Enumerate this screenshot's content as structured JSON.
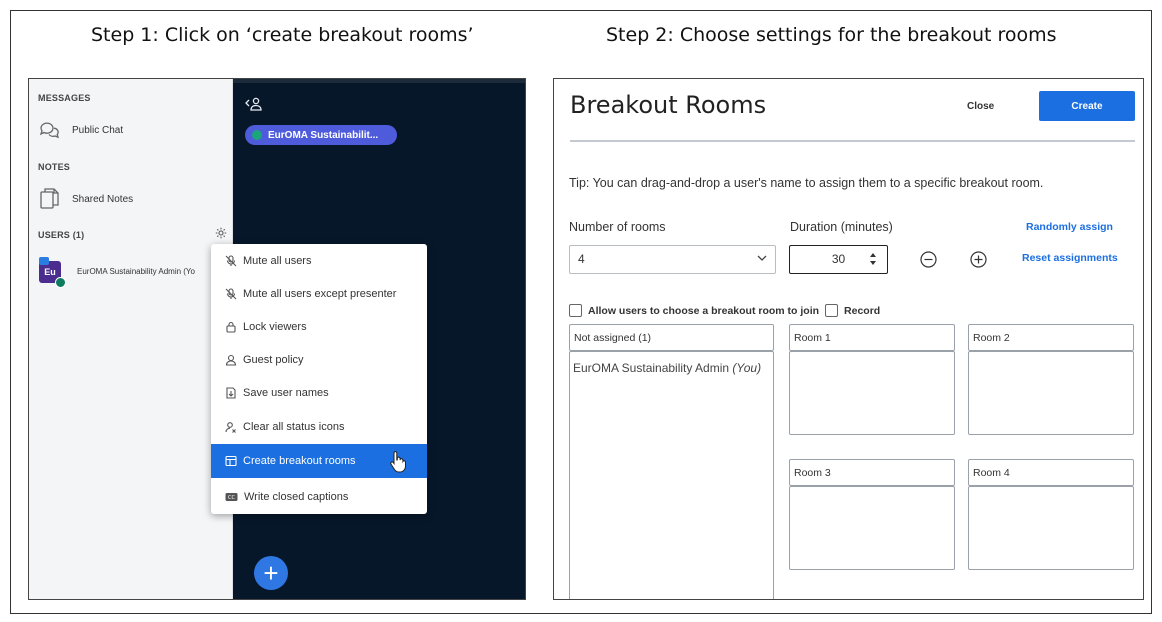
{
  "captions": {
    "step1": "Step 1: Click on ‘create breakout rooms’",
    "step2": "Step 2: Choose settings for the breakout rooms"
  },
  "left_panel": {
    "messages_header": "MESSAGES",
    "public_chat": "Public Chat",
    "notes_header": "NOTES",
    "shared_notes": "Shared Notes",
    "users_header": "USERS (1)",
    "user_avatar": "Eu",
    "user_name": "EurOMA Sustainability Admin (Yo",
    "chat_pill": "EurOMA Sustainabilit..."
  },
  "user_menu": {
    "items": [
      {
        "label": "Mute all users",
        "icon": "mute-icon"
      },
      {
        "label": "Mute all users except presenter",
        "icon": "mute-icon"
      },
      {
        "label": "Lock viewers",
        "icon": "lock-icon"
      },
      {
        "label": "Guest policy",
        "icon": "user-icon"
      },
      {
        "label": "Save user names",
        "icon": "download-icon"
      },
      {
        "label": "Clear all status icons",
        "icon": "clear-status-icon"
      },
      {
        "label": "Create breakout rooms",
        "icon": "rooms-icon",
        "active": true
      },
      {
        "label": "Write closed captions",
        "icon": "cc-icon"
      }
    ]
  },
  "breakout": {
    "title": "Breakout Rooms",
    "close": "Close",
    "create": "Create",
    "tip": "Tip: You can drag-and-drop a user's name to assign them to a specific breakout room.",
    "rooms_label": "Number of rooms",
    "rooms_value": "4",
    "duration_label": "Duration (minutes)",
    "duration_value": "30",
    "randomly_assign": "Randomly assign",
    "reset_assignments": "Reset assignments",
    "allow_choose": "Allow users to choose a breakout room to join",
    "record": "Record",
    "not_assigned": "Not assigned (1)",
    "assigned_user": "EurOMA Sustainability Admin",
    "assigned_user_suffix": "(You)",
    "room1": "Room 1",
    "room2": "Room 2",
    "room3": "Room 3",
    "room4": "Room 4"
  },
  "colors": {
    "accent": "#1b6fe0",
    "dark_bg": "#06172a",
    "pill": "#4e5bdb"
  }
}
